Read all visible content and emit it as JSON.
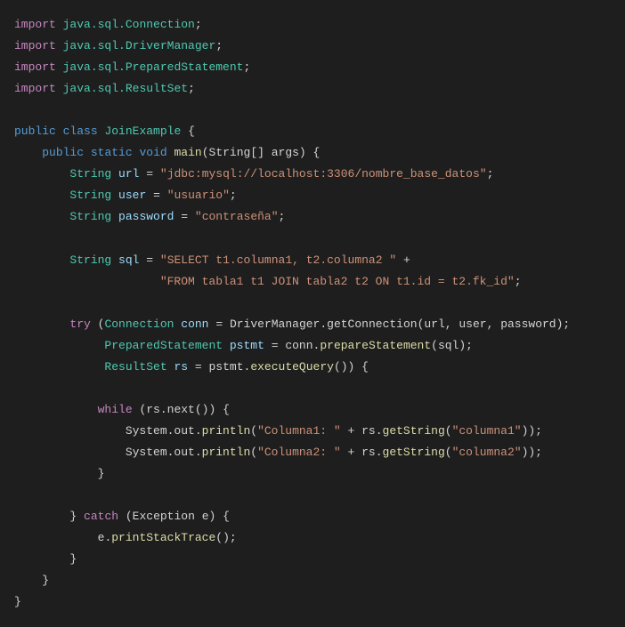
{
  "code": {
    "imports": [
      {
        "kw": "import",
        "pkg": "java.sql.Connection"
      },
      {
        "kw": "import",
        "pkg": "java.sql.DriverManager"
      },
      {
        "kw": "import",
        "pkg": "java.sql.PreparedStatement"
      },
      {
        "kw": "import",
        "pkg": "java.sql.ResultSet"
      }
    ],
    "classDecl": {
      "pub": "public",
      "cls": "class",
      "name": "JoinExample",
      "brace": "{"
    },
    "mainDecl": {
      "pub": "public",
      "stat": "static",
      "void": "void",
      "name": "main",
      "params": "(String[] args) {"
    },
    "vars": {
      "url": {
        "type": "String",
        "name": "url",
        "eq": "=",
        "val": "\"jdbc:mysql://localhost:3306/nombre_base_datos\"",
        "semi": ";"
      },
      "user": {
        "type": "String",
        "name": "user",
        "eq": "=",
        "val": "\"usuario\"",
        "semi": ";"
      },
      "password": {
        "type": "String",
        "name": "password",
        "eq": "=",
        "val": "\"contraseña\"",
        "semi": ";"
      },
      "sql": {
        "type": "String",
        "name": "sql",
        "eq": "=",
        "val1": "\"SELECT t1.columna1, t2.columna2 \"",
        "plus": "+",
        "val2": "\"FROM tabla1 t1 JOIN tabla2 t2 ON t1.id = t2.fk_id\"",
        "semi": ";"
      }
    },
    "try": {
      "kw": "try",
      "open": "(",
      "c1": {
        "type": "Connection",
        "name": "conn",
        "eq": "=",
        "call": "DriverManager.getConnection",
        "args": "(url, user, password);"
      },
      "c2": {
        "type": "PreparedStatement",
        "name": "pstmt",
        "eq": "=",
        "obj": "conn",
        "call": "prepareStatement",
        "args": "(sql);"
      },
      "c3": {
        "type": "ResultSet",
        "name": "rs",
        "eq": "=",
        "obj": "pstmt",
        "call": "executeQuery",
        "args": "()) {"
      }
    },
    "while": {
      "kw": "while",
      "cond": "(rs.next()) {"
    },
    "prints": [
      {
        "obj": "System.out",
        "call": "println",
        "open": "(",
        "lit": "\"Columna1: \"",
        "plus": " + ",
        "obj2": "rs",
        "call2": "getString",
        "open2": "(",
        "arg": "\"columna1\"",
        "close": "));"
      },
      {
        "obj": "System.out",
        "call": "println",
        "open": "(",
        "lit": "\"Columna2: \"",
        "plus": " + ",
        "obj2": "rs",
        "call2": "getString",
        "open2": "(",
        "arg": "\"columna2\"",
        "close": "));"
      }
    ],
    "closeWhile": "}",
    "catch": {
      "closeTry": "}",
      "kw": "catch",
      "params": "(Exception e) {"
    },
    "printStack": {
      "obj": "e",
      "call": "printStackTrace",
      "rest": "();"
    },
    "closeCatch": "}",
    "closeMain": "}",
    "closeClass": "}"
  }
}
